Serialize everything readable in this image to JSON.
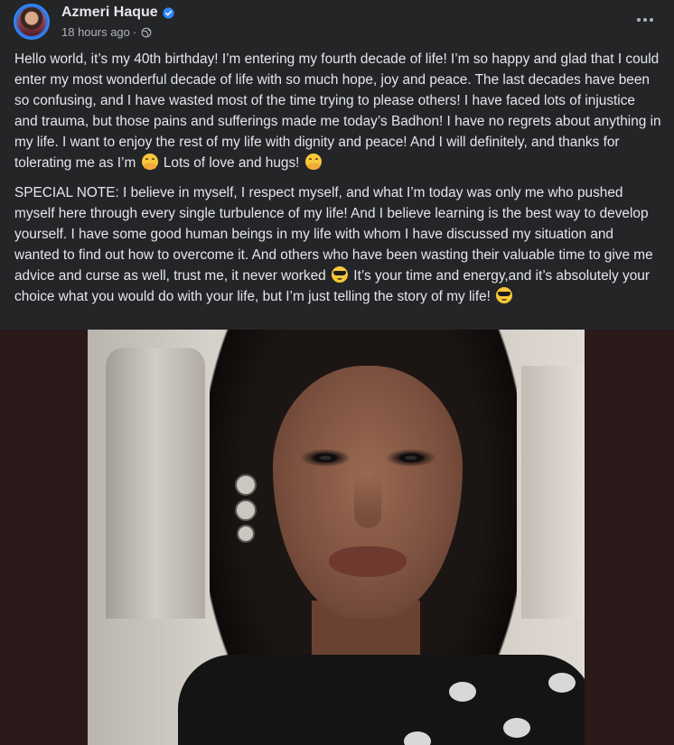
{
  "header": {
    "author_name": "Azmeri Haque",
    "timestamp": "18 hours ago",
    "separator": "·",
    "verified_icon": "verified-badge-icon",
    "privacy_icon": "globe-icon",
    "more_icon": "more-options-icon"
  },
  "post": {
    "para1": {
      "text_a": "Hello world, it’s my 40th birthday! I’m entering my fourth decade of life! I’m so happy and glad that I could enter my most wonderful decade of life with so much hope, joy and peace. The last decades have been so confusing, and I have wasted most of the time trying to please others! I have faced lots of injustice and trauma, but those pains and sufferings made me today’s Badhon! I have no regrets about anything in my life. I want to enjoy the rest of my life with dignity and peace! And I will definitely, and thanks for tolerating me as I’m",
      "text_b": "Lots of love and hugs!"
    },
    "para2": {
      "text_a": "SPECIAL NOTE: I believe in myself, I respect myself, and what I’m today was only me who pushed myself here through every single turbulence of my life! And I believe learning is the best way to develop yourself. I have some good human beings in my life with whom I have discussed my situation and wanted to find out how to overcome it. And others who have been wasting their valuable time to give me advice and curse as well, trust me, it never worked",
      "text_b": "It’s your time and energy,and it’s absolutely your choice what you would do with your life, but I’m just telling the story of my life!"
    },
    "emojis": {
      "shy": "shy-smile-emoji",
      "cool": "sunglasses-emoji"
    }
  },
  "colors": {
    "background": "#242526",
    "text_primary": "#e4e6eb",
    "text_secondary": "#b0b3b8",
    "verified_blue": "#2d88ff",
    "photo_frame": "#2a1a1a"
  }
}
